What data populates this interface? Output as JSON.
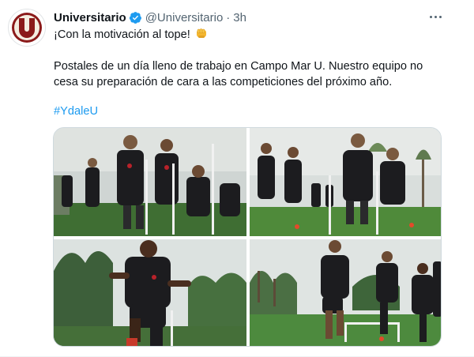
{
  "tweet": {
    "author_name": "Universitario",
    "author_handle": "@Universitario",
    "separator": "·",
    "time": "3h",
    "line1": "¡Con la motivación al tope!",
    "line2": "Postales de un día lleno de trabajo en Campo Mar U. Nuestro equipo no",
    "line3": "cesa su preparación de cara a las competiciones del próximo año.",
    "hashtag": "#YdaleU"
  },
  "icons": {
    "avatar": "universitario-u-logo",
    "verified": "verified-badge-icon",
    "emoji": "fist-emoji-icon",
    "more": "more-options-icon"
  },
  "colors": {
    "link": "#1d9bf0",
    "secondary_text": "#536471",
    "logo_red": "#8b1a1a",
    "kit_dark": "#1b1b1d",
    "grass": "#4f8a3a"
  },
  "media": {
    "photos": [
      "training-photo-1",
      "training-photo-2",
      "training-photo-3",
      "training-photo-4"
    ]
  }
}
